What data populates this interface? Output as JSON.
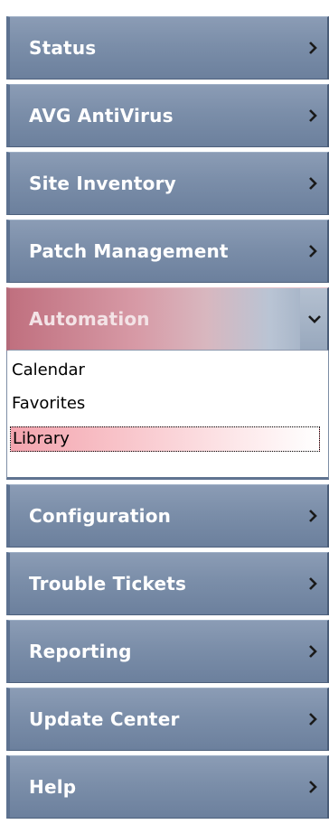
{
  "menu": {
    "items": [
      {
        "label": "Status",
        "icon": "chevron-right-icon"
      },
      {
        "label": "AVG AntiVirus",
        "icon": "chevron-right-icon"
      },
      {
        "label": "Site Inventory",
        "icon": "chevron-right-icon"
      },
      {
        "label": "Patch Management",
        "icon": "chevron-right-icon"
      },
      {
        "label": "Automation",
        "icon": "chevron-down-icon",
        "expanded": true
      },
      {
        "label": "Configuration",
        "icon": "chevron-right-icon"
      },
      {
        "label": "Trouble Tickets",
        "icon": "chevron-right-icon"
      },
      {
        "label": "Reporting",
        "icon": "chevron-right-icon"
      },
      {
        "label": "Update Center",
        "icon": "chevron-right-icon"
      },
      {
        "label": "Help",
        "icon": "chevron-right-icon"
      }
    ],
    "automation_submenu": {
      "items": [
        {
          "label": "Calendar"
        },
        {
          "label": "Favorites"
        },
        {
          "label": "Library",
          "selected": true
        }
      ]
    }
  },
  "colors": {
    "menu_blue": "#7b8ea9",
    "active_rose": "#c0707f",
    "selected_pink": "#f3a4ae"
  }
}
